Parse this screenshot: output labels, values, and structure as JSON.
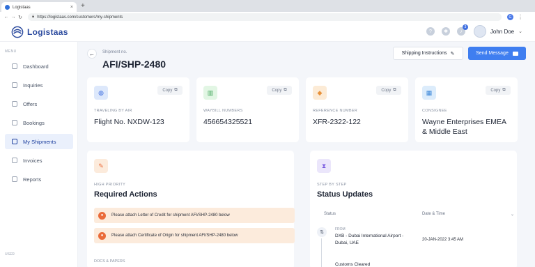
{
  "browser": {
    "tab_title": "Logistaas",
    "url": "https://logistaas.com/customers/my-shipments"
  },
  "app": {
    "logo": "Logistaas",
    "notifications_count": "3",
    "user_name": "John Doe"
  },
  "sidebar": {
    "menu_label": "MENU",
    "user_label": "USER",
    "items": [
      {
        "label": "Dashboard",
        "active": false
      },
      {
        "label": "Inquiries",
        "active": false
      },
      {
        "label": "Offers",
        "active": false
      },
      {
        "label": "Bookings",
        "active": false
      },
      {
        "label": "My Shipments",
        "active": true
      },
      {
        "label": "Invoices",
        "active": false
      },
      {
        "label": "Reports",
        "active": false
      }
    ]
  },
  "shipment": {
    "label": "Shipment no.",
    "number": "AFI/SHP-2480",
    "instructions_btn": "Shipping Instructions",
    "send_btn": "Send Message"
  },
  "cards": [
    {
      "label": "TRAVELING BY AIR",
      "value": "Flight No. NXDW-123",
      "copy": "Copy",
      "icon": "globe-icon",
      "color": "#dde8fb"
    },
    {
      "label": "WAYBILL NUMBERS",
      "value": "456654325521",
      "copy": "Copy",
      "icon": "barcode-icon",
      "color": "#e2f6e4"
    },
    {
      "label": "REFERENCE NUMBER",
      "value": "XFR-2322-122",
      "copy": "Copy",
      "icon": "tag-icon",
      "color": "#fcebd6"
    },
    {
      "label": "CONSIGNEE",
      "value": "Wayne Enterprises EMEA & Middle East",
      "copy": "Copy",
      "icon": "building-icon",
      "color": "#dcecfb"
    }
  ],
  "actions_panel": {
    "label": "HIGH PRIORITY",
    "title": "Required Actions",
    "items": [
      "Please attach Letter of Credit for shipment AFI/SHP-2480 below",
      "Please attach Certificate of Origin for shipment AFI/SHP-2480 below"
    ],
    "docs_label": "DOCS & PAPERS"
  },
  "status_panel": {
    "label": "STEP BY STEP",
    "title": "Status Updates",
    "col_status": "Status",
    "col_date": "Date & Time",
    "rows": [
      {
        "from": "FROM",
        "location": "DXB - Dubai International Airport - Dubai, UAE",
        "date": "20-JAN-2022 3:45 AM"
      }
    ],
    "next": "Customs Cleared"
  }
}
